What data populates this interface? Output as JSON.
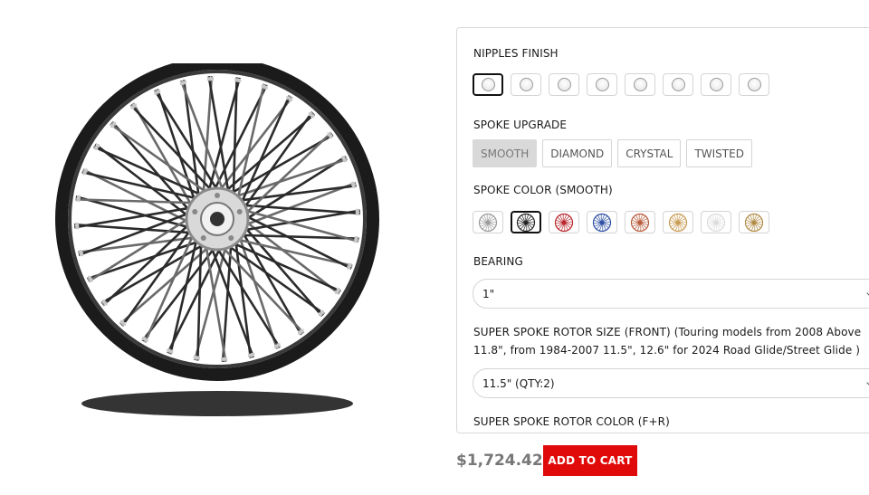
{
  "product": {
    "image_alt": "spoke-wheel-image"
  },
  "options": {
    "nipples_finish": {
      "label": "NIPPLES FINISH",
      "swatches": [
        "clear",
        "chrome",
        "chrome-2",
        "blue-chrome",
        "dark-chrome",
        "polished",
        "white",
        "silver"
      ],
      "selected_index": 0
    },
    "spoke_upgrade": {
      "label": "SPOKE UPGRADE",
      "choices": [
        "SMOOTH",
        "DIAMOND",
        "CRYSTAL",
        "TWISTED"
      ],
      "selected_index": 0
    },
    "spoke_color": {
      "label": "SPOKE COLOR (SMOOTH)",
      "swatches": [
        {
          "name": "silver",
          "color": "#9a9a9a"
        },
        {
          "name": "black",
          "color": "#222222"
        },
        {
          "name": "red",
          "color": "#b8262b"
        },
        {
          "name": "blue",
          "color": "#2d4ea3"
        },
        {
          "name": "copper",
          "color": "#b85a3a"
        },
        {
          "name": "gold",
          "color": "#c89a52"
        },
        {
          "name": "white",
          "color": "#dcdcdc"
        },
        {
          "name": "bronze",
          "color": "#b08a45"
        }
      ],
      "selected_index": 1
    },
    "bearing": {
      "label": "BEARING",
      "value": "1\""
    },
    "rotor_size": {
      "label": "SUPER SPOKE ROTOR SIZE (FRONT) (Touring models from 2008 Above 11.8\", from 1984-2007 11.5\", 12.6\" for 2024 Road Glide/Street Glide )",
      "value": "11.5\" (QTY:2)"
    },
    "rotor_color": {
      "label": "SUPER SPOKE ROTOR COLOR (F+R)"
    }
  },
  "purchase": {
    "price": "$1,724.42",
    "add_to_cart_label": "ADD TO CART"
  },
  "colors": {
    "accent": "#e10a0a",
    "price": "#777777"
  }
}
